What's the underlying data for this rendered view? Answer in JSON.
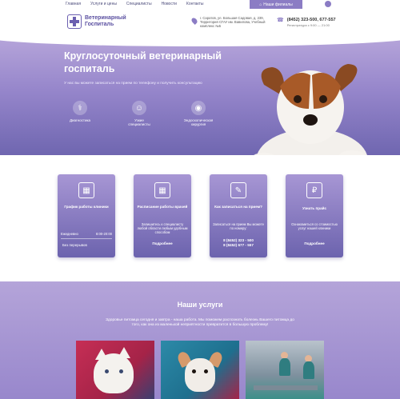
{
  "nav": {
    "items": [
      "Главная",
      "Услуги и цены",
      "Специалисты",
      "Новости",
      "Контакты"
    ],
    "branches_button": "Наши филиалы"
  },
  "header": {
    "logo_line1": "Ветеринарный",
    "logo_line2": "Госпиталь",
    "address": "г. Саратов, ул. Большая Садовая, д. 239, Территория СГАУ им. Вавилова, Учебный комплекс №5",
    "phone": "(8452) 323-500, 677-557",
    "phone_note": "Регистратура с 9:00 — 21:00"
  },
  "hero": {
    "title": "Круглосуточный ветеринарный госпиталь",
    "subtitle": "У нас вы можете записаться на прием по телефону и получить консультацию",
    "features": [
      "Диагностика",
      "Узкие специалисты",
      "Эндоскопическая хирургия"
    ]
  },
  "cards": [
    {
      "title": "График работы клиники",
      "row_label": "Ежедневно",
      "row_value": "8:00-20:00",
      "footer": "Без перерывов"
    },
    {
      "title": "Расписание работы врачей",
      "body": "Запишитесь к специалисту любой области любым удобным способом",
      "link": "Подробнее"
    },
    {
      "title": "Как записаться на прием?",
      "body": "Записаться на прием Вы можете по номеру:",
      "phone1": "8 (8452) 323 - 500",
      "phone2": "8 (8452) 677 - 557"
    },
    {
      "title": "Узнать прайс",
      "body": "Ознакомиться со стоимостью услуг нашей клиники",
      "link": "Подробнее"
    }
  ],
  "services": {
    "title": "Наши услуги",
    "text": "Здоровье питомца сегодня и завтра - наша работа. Мы поможем распознать болезнь Вашего питомца до того, как она из маленькой неприятности превратится в большую проблему!"
  },
  "colors": {
    "accent": "#8b7cc4",
    "hero_top": "#b6a5da",
    "hero_bottom": "#6f66b0",
    "card_top": "#a796d4",
    "card_bottom": "#6c63ae"
  }
}
